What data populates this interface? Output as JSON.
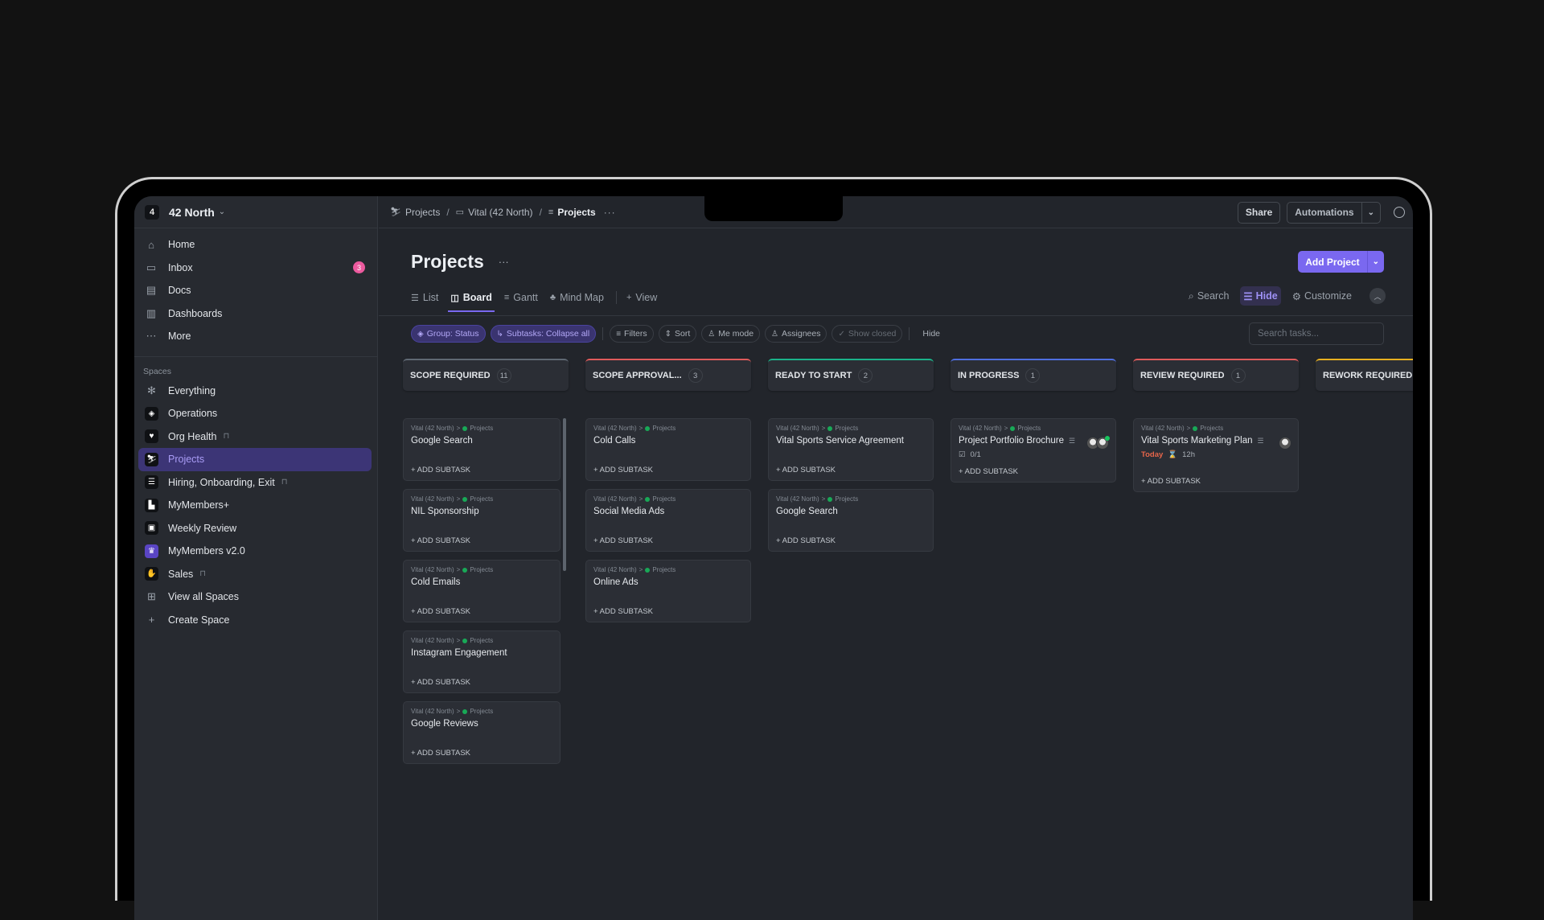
{
  "workspace": {
    "badge": "4",
    "name": "42 North"
  },
  "sidebar": {
    "nav": [
      {
        "icon": "home-icon",
        "glyph": "⌂",
        "label": "Home"
      },
      {
        "icon": "inbox-icon",
        "glyph": "▭",
        "label": "Inbox",
        "badge": "3"
      },
      {
        "icon": "docs-icon",
        "glyph": "▤",
        "label": "Docs"
      },
      {
        "icon": "dashboards-icon",
        "glyph": "▥",
        "label": "Dashboards"
      },
      {
        "icon": "more-icon",
        "glyph": "⋯",
        "label": "More"
      }
    ],
    "spaces_heading": "Spaces",
    "spaces": [
      {
        "icon": "everything-icon",
        "glyph": "✻",
        "label": "Everything",
        "plain": true
      },
      {
        "icon": "compass-icon",
        "glyph": "◈",
        "label": "Operations"
      },
      {
        "icon": "heart-pulse-icon",
        "glyph": "♥",
        "label": "Org Health",
        "locked": true
      },
      {
        "icon": "skier-icon",
        "glyph": "⛷",
        "label": "Projects",
        "active": true
      },
      {
        "icon": "checklist-icon",
        "glyph": "☰",
        "label": "Hiring, Onboarding, Exit",
        "locked": true
      },
      {
        "icon": "chart-icon",
        "glyph": "▙",
        "label": "MyMembers+"
      },
      {
        "icon": "calendar-icon",
        "glyph": "▣",
        "label": "Weekly Review"
      },
      {
        "icon": "trophy-icon",
        "glyph": "♛",
        "label": "MyMembers v2.0",
        "purple": true
      },
      {
        "icon": "handshake-icon",
        "glyph": "✋",
        "label": "Sales",
        "locked": true
      },
      {
        "icon": "grid-icon",
        "glyph": "⊞",
        "label": "View all Spaces",
        "plain": true
      },
      {
        "icon": "plus-icon",
        "glyph": "+",
        "label": "Create Space",
        "plain": true
      }
    ]
  },
  "breadcrumb": [
    {
      "icon": "skier-icon",
      "glyph": "⛷",
      "label": "Projects"
    },
    {
      "icon": "folder-icon",
      "glyph": "▭",
      "label": "Vital (42 North)"
    },
    {
      "icon": "list-icon",
      "glyph": "≡",
      "label": "Projects"
    }
  ],
  "topbar": {
    "share": "Share",
    "automations": "Automations"
  },
  "page": {
    "title": "Projects",
    "add_button": "Add Project"
  },
  "tabs": [
    {
      "icon": "list-icon",
      "glyph": "☰",
      "label": "List"
    },
    {
      "icon": "board-icon",
      "glyph": "◫",
      "label": "Board",
      "active": true
    },
    {
      "icon": "gantt-icon",
      "glyph": "≡",
      "label": "Gantt"
    },
    {
      "icon": "mindmap-icon",
      "glyph": "♣",
      "label": "Mind Map"
    },
    {
      "icon": "plus-icon",
      "glyph": "+",
      "label": "View"
    }
  ],
  "view_tools": {
    "search": "Search",
    "hide": "Hide",
    "customize": "Customize"
  },
  "filters": {
    "group": "Group: Status",
    "subtasks": "Subtasks: Collapse all",
    "filters": "Filters",
    "sort": "Sort",
    "me_mode": "Me mode",
    "assignees": "Assignees",
    "show_closed": "Show closed",
    "hide": "Hide",
    "search_placeholder": "Search tasks..."
  },
  "card_common": {
    "path_space": "Vital (42 North)",
    "path_list": "Projects",
    "add_subtask": "+ ADD SUBTASK"
  },
  "columns": [
    {
      "name": "SCOPE REQUIRED",
      "count": "11",
      "color": "#5f6873",
      "cards": [
        {
          "title": "Google Search"
        },
        {
          "title": "NIL Sponsorship"
        },
        {
          "title": "Cold Emails"
        },
        {
          "title": "Instagram Engagement"
        },
        {
          "title": "Google Reviews"
        }
      ]
    },
    {
      "name": "SCOPE APPROVAL...",
      "count": "3",
      "color": "#e05b5b",
      "cards": [
        {
          "title": "Cold Calls"
        },
        {
          "title": "Social Media Ads"
        },
        {
          "title": "Online Ads"
        }
      ]
    },
    {
      "name": "READY TO START",
      "count": "2",
      "color": "#1bb38a",
      "cards": [
        {
          "title": "Vital Sports Service Agreement"
        },
        {
          "title": "Google Search"
        }
      ]
    },
    {
      "name": "IN PROGRESS",
      "count": "1",
      "color": "#4f6fe0",
      "cards": [
        {
          "title": "Project Portfolio Brochure",
          "checklist": "0/1",
          "avatars": 2
        }
      ]
    },
    {
      "name": "REVIEW REQUIRED",
      "count": "1",
      "color": "#e05b5b",
      "cards": [
        {
          "title": "Vital Sports Marketing Plan",
          "due": "Today",
          "estimate": "12h",
          "avatars": 1
        }
      ]
    },
    {
      "name": "REWORK REQUIRED",
      "count": "",
      "color": "#e8b020",
      "cards": []
    }
  ]
}
